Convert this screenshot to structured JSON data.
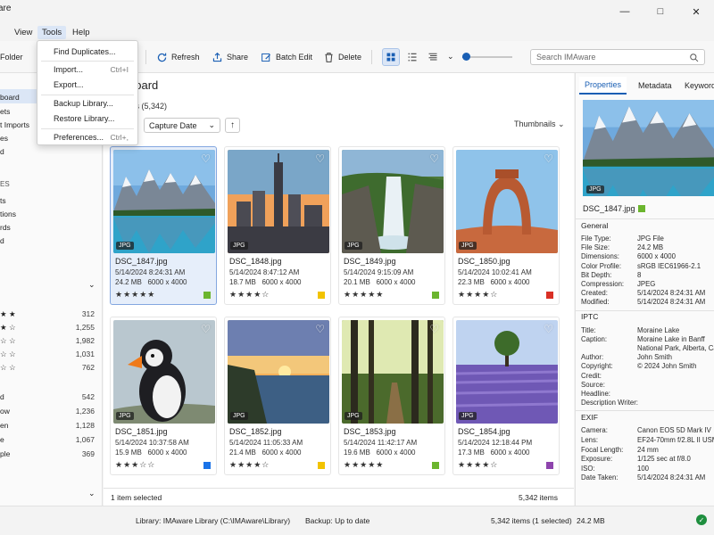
{
  "app": {
    "title": "are"
  },
  "menu": {
    "items": [
      "View",
      "Tools",
      "Help"
    ],
    "active": "Tools"
  },
  "toolbar": {
    "folder_label": "Folder",
    "refresh": "Refresh",
    "share": "Share",
    "batch_edit": "Batch Edit",
    "delete": "Delete",
    "search_placeholder": "Search IMAware"
  },
  "tools_menu": [
    {
      "label": "Find Duplicates...",
      "shortcut": ""
    },
    {
      "label": "Import...",
      "shortcut": "Ctrl+I"
    },
    {
      "label": "Export...",
      "shortcut": ""
    },
    {
      "label": "Backup Library...",
      "shortcut": ""
    },
    {
      "label": "Restore Library...",
      "shortcut": ""
    },
    {
      "label": "Preferences...",
      "shortcut": "Ctrl+,"
    }
  ],
  "sidebar": {
    "items": [
      {
        "label": "board",
        "count": ""
      },
      {
        "label": "ets",
        "count": ""
      },
      {
        "label": "t Imports",
        "count": ""
      },
      {
        "label": "es",
        "count": ""
      },
      {
        "label": "d",
        "count": ""
      },
      {
        "label": "ES",
        "count": ""
      },
      {
        "label": "ts",
        "count": ""
      },
      {
        "label": "tions",
        "count": ""
      },
      {
        "label": "rds",
        "count": ""
      },
      {
        "label": "d",
        "count": ""
      },
      {
        "label": "★ ★",
        "count": "312"
      },
      {
        "label": "★ ☆",
        "count": "1,255"
      },
      {
        "label": "☆ ☆",
        "count": "1,982"
      },
      {
        "label": "☆ ☆",
        "count": "1,031"
      },
      {
        "label": "☆ ☆",
        "count": "762"
      },
      {
        "label": "d",
        "count": "542"
      },
      {
        "label": "ow",
        "count": "1,236"
      },
      {
        "label": "en",
        "count": "1,128"
      },
      {
        "label": "e",
        "count": "1,067"
      },
      {
        "label": "ple",
        "count": "369"
      }
    ]
  },
  "main": {
    "heading": "board",
    "subtitle": "ats (5,342)",
    "sort_value": "Capture Date",
    "view_mode": "Thumbnails",
    "status_left": "1 item selected",
    "status_right": "5,342 items"
  },
  "photos": [
    {
      "name": "DSC_1847.jpg",
      "date": "5/14/2024 8:24:31 AM",
      "size": "24.2 MB",
      "dims": "6000 x 4000",
      "type": "JPG",
      "rating": 5,
      "flag": "#6bb52e",
      "scene": "lake"
    },
    {
      "name": "DSC_1848.jpg",
      "date": "5/14/2024 8:47:12 AM",
      "size": "18.7 MB",
      "dims": "6000 x 4000",
      "type": "JPG",
      "rating": 4,
      "flag": "#f2c300",
      "scene": "city"
    },
    {
      "name": "DSC_1849.jpg",
      "date": "5/14/2024 9:15:09 AM",
      "size": "20.1 MB",
      "dims": "6000 x 4000",
      "type": "JPG",
      "rating": 5,
      "flag": "#6bb52e",
      "scene": "waterfall"
    },
    {
      "name": "DSC_1850.jpg",
      "date": "5/14/2024 10:02:41 AM",
      "size": "22.3 MB",
      "dims": "6000 x 4000",
      "type": "JPG",
      "rating": 4,
      "flag": "#d93025",
      "scene": "arch"
    },
    {
      "name": "DSC_1851.jpg",
      "date": "5/14/2024 10:37:58 AM",
      "size": "15.9 MB",
      "dims": "6000 x 4000",
      "type": "JPG",
      "rating": 3,
      "flag": "#1a73e8",
      "scene": "puffin"
    },
    {
      "name": "DSC_1852.jpg",
      "date": "5/14/2024 11:05:33 AM",
      "size": "21.4 MB",
      "dims": "6000 x 4000",
      "type": "JPG",
      "rating": 4,
      "flag": "#f2c300",
      "scene": "sunset"
    },
    {
      "name": "DSC_1853.jpg",
      "date": "5/14/2024 11:42:17 AM",
      "size": "19.6 MB",
      "dims": "6000 x 4000",
      "type": "JPG",
      "rating": 5,
      "flag": "#6bb52e",
      "scene": "forest"
    },
    {
      "name": "DSC_1854.jpg",
      "date": "5/14/2024 12:18:44 PM",
      "size": "17.3 MB",
      "dims": "6000 x 4000",
      "type": "JPG",
      "rating": 4,
      "flag": "#8e44ad",
      "scene": "lavender"
    }
  ],
  "properties": {
    "tabs": [
      "Properties",
      "Metadata",
      "Keywords"
    ],
    "file_name": "DSC_1847.jpg",
    "preview_type": "JPG",
    "general_title": "General",
    "general": [
      {
        "k": "File Type:",
        "v": "JPG File"
      },
      {
        "k": "File Size:",
        "v": "24.2 MB"
      },
      {
        "k": "Dimensions:",
        "v": "6000 x 4000"
      },
      {
        "k": "Color Profile:",
        "v": "sRGB IEC61966-2.1"
      },
      {
        "k": "Bit Depth:",
        "v": "8"
      },
      {
        "k": "Compression:",
        "v": "JPEG"
      },
      {
        "k": "Created:",
        "v": "5/14/2024 8:24:31 AM"
      },
      {
        "k": "Modified:",
        "v": "5/14/2024 8:24:31 AM"
      }
    ],
    "iptc_title": "IPTC",
    "iptc": [
      {
        "k": "Title:",
        "v": "Moraine Lake"
      },
      {
        "k": "Caption:",
        "v": "Moraine Lake in Banff"
      },
      {
        "k": "",
        "v": "National Park, Alberta, Ca"
      },
      {
        "k": "Author:",
        "v": "John Smith"
      },
      {
        "k": "Copyright:",
        "v": "© 2024 John Smith"
      },
      {
        "k": "Credit:",
        "v": ""
      },
      {
        "k": "Source:",
        "v": ""
      },
      {
        "k": "Headline:",
        "v": ""
      },
      {
        "k": "Description Writer:",
        "v": ""
      }
    ],
    "exif_title": "EXIF",
    "exif": [
      {
        "k": "Camera:",
        "v": "Canon EOS 5D Mark IV"
      },
      {
        "k": "Lens:",
        "v": "EF24-70mm f/2.8L II USM"
      },
      {
        "k": "Focal Length:",
        "v": "24 mm"
      },
      {
        "k": "Exposure:",
        "v": "1/125 sec at f/8.0"
      },
      {
        "k": "ISO:",
        "v": "100"
      },
      {
        "k": "Date Taken:",
        "v": "5/14/2024 8:24:31 AM"
      }
    ]
  },
  "statusbar": {
    "library": "Library: IMAware Library (C:\\IMAware\\Library)",
    "backup": "Backup:  Up to date",
    "items": "5,342 items (1 selected)",
    "size": "24.2 MB"
  },
  "colors": {
    "accent": "#1a5fb4",
    "selection": "#dbe6f6"
  }
}
